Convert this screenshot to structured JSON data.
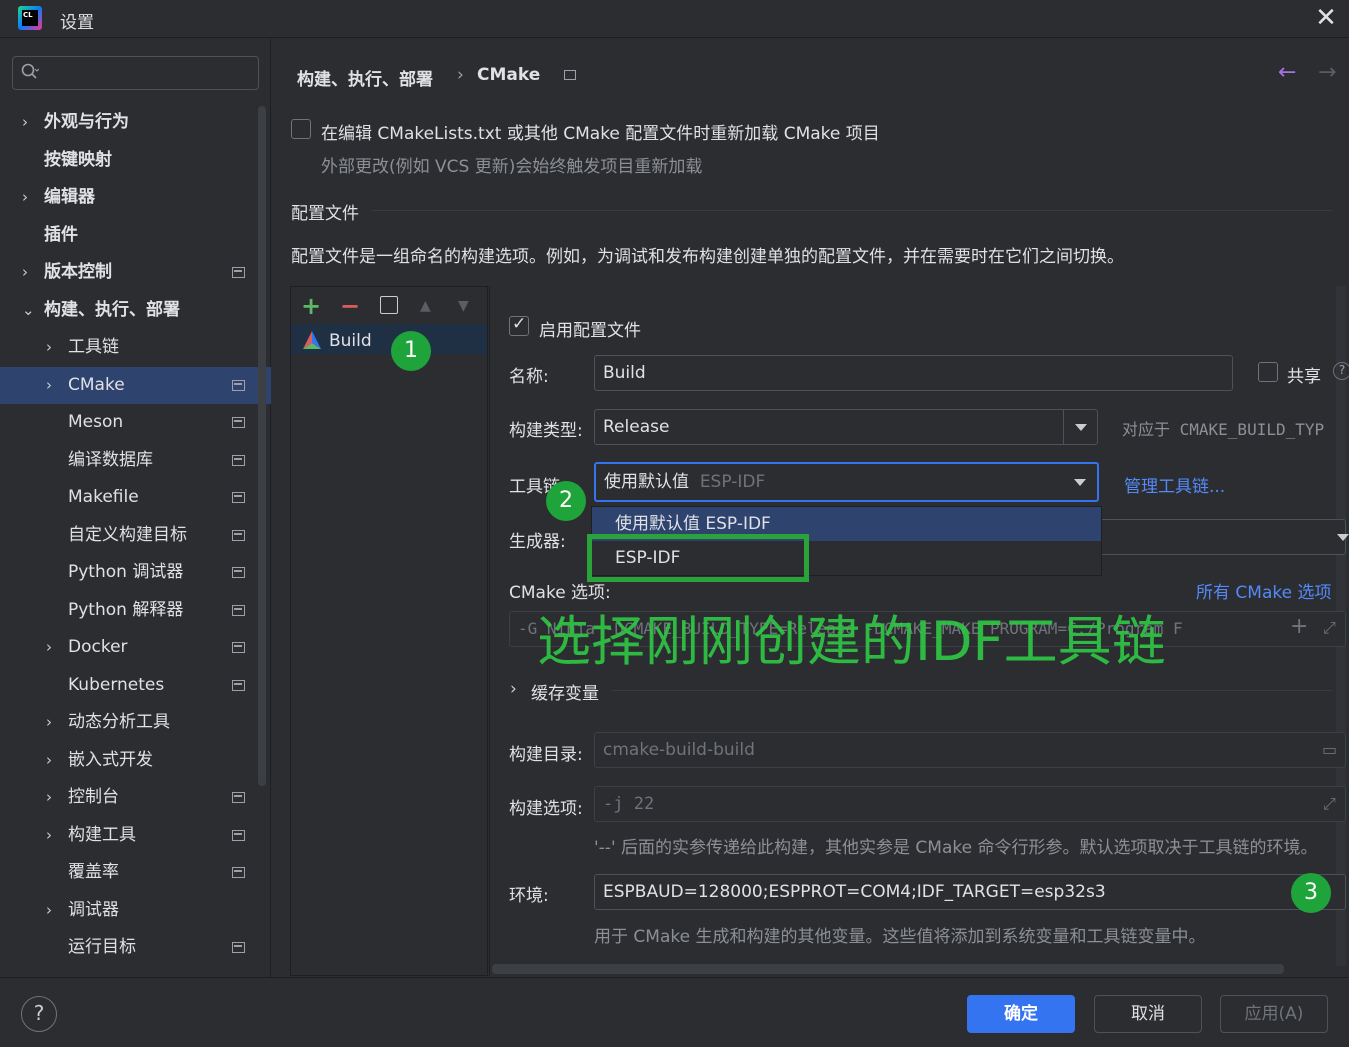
{
  "window": {
    "title": "设置",
    "app_icon_text": "CL"
  },
  "search": {
    "placeholder": "",
    "value": ""
  },
  "sidebar": {
    "items": [
      {
        "label": "外观与行为",
        "chevron": "›",
        "bold": true
      },
      {
        "label": "按键映射",
        "bold": true
      },
      {
        "label": "编辑器",
        "chevron": "›",
        "bold": true
      },
      {
        "label": "插件",
        "bold": true
      },
      {
        "label": "版本控制",
        "chevron": "›",
        "bold": true
      },
      {
        "label": "构建、执行、部署",
        "chevron": "⌄",
        "bold": true
      },
      {
        "label": "工具链",
        "chevron": "›"
      },
      {
        "label": "CMake",
        "chevron": "›"
      },
      {
        "label": "Meson"
      },
      {
        "label": "编译数据库"
      },
      {
        "label": "Makefile"
      },
      {
        "label": "自定义构建目标"
      },
      {
        "label": "Python 调试器"
      },
      {
        "label": "Python 解释器"
      },
      {
        "label": "Docker",
        "chevron": "›"
      },
      {
        "label": "Kubernetes"
      },
      {
        "label": "动态分析工具",
        "chevron": "›"
      },
      {
        "label": "嵌入式开发",
        "chevron": "›"
      },
      {
        "label": "控制台",
        "chevron": "›"
      },
      {
        "label": "构建工具",
        "chevron": "›"
      },
      {
        "label": "覆盖率"
      },
      {
        "label": "调试器",
        "chevron": "›"
      },
      {
        "label": "运行目标"
      }
    ]
  },
  "breadcrumb": {
    "parent": "构建、执行、部署",
    "separator": "›",
    "current": "CMake"
  },
  "nav": {
    "back": "←",
    "forward": "→"
  },
  "reload": {
    "checked": false,
    "label": "在编辑 CMakeLists.txt 或其他 CMake 配置文件时重新加载 CMake 项目",
    "hint": "外部更改(例如 VCS 更新)会始终触发项目重新加载"
  },
  "profiles": {
    "heading": "配置文件",
    "description": "配置文件是一组命名的构建选项。例如，为调试和发布构建创建单独的配置文件，并在需要时在它们之间切换。",
    "toolbar": {
      "add": "+",
      "remove": "−",
      "up": "▲",
      "down": "▼"
    },
    "list": [
      {
        "name": "Build",
        "selected": true
      }
    ]
  },
  "details": {
    "enable_label": "启用配置文件",
    "enable_checked": true,
    "name_label": "名称:",
    "name_value": "Build",
    "share_label": "共享",
    "share_help": "?",
    "build_type_label": "构建类型:",
    "build_type_value": "Release",
    "build_type_hint": "对应于 CMAKE_BUILD_TYP",
    "toolchain_label": "工具链:",
    "toolchain_value_prefix": "使用默认值",
    "toolchain_value_suffix": "ESP-IDF",
    "manage_toolchains": "管理工具链...",
    "generator_label": "生成器:",
    "dropdown_options": [
      {
        "label": "使用默认值  ESP-IDF",
        "selected": true
      },
      {
        "label": "ESP-IDF",
        "selected": false
      }
    ],
    "cmake_options_label": "CMake 选项:",
    "all_cmake_options": "所有 CMake 选项",
    "cmake_options_value": "-G Ninja -DCMAKE_BUILD_TYPE=Release -DCMAKE_MAKE_PROGRAM=C:/Program F",
    "cache_vars": "缓存变量",
    "build_dir_label": "构建目录:",
    "build_dir_value": "cmake-build-build",
    "build_opts_label": "构建选项:",
    "build_opts_value": "-j 22",
    "build_opts_hint": "'--' 后面的实参传递给此构建，其他实参是 CMake 命令行形参。默认选项取决于工具链的环境。",
    "env_label": "环境:",
    "env_value": "ESPBAUD=128000;ESPPROT=COM4;IDF_TARGET=esp32s3",
    "env_hint": "用于 CMake 生成和构建的其他变量。这些值将添加到系统变量和工具链变量中。"
  },
  "annotation": {
    "overlay_text": "选择刚刚创建的IDF工具链",
    "badges": [
      "1",
      "2",
      "3"
    ],
    "color": "#2fc744"
  },
  "buttons": {
    "help": "?",
    "ok": "确定",
    "cancel": "取消",
    "apply": "应用(A)"
  },
  "colors": {
    "accent": "#3574f0",
    "selection": "#2e436e",
    "link": "#548af7",
    "background": "#2b2d30"
  }
}
